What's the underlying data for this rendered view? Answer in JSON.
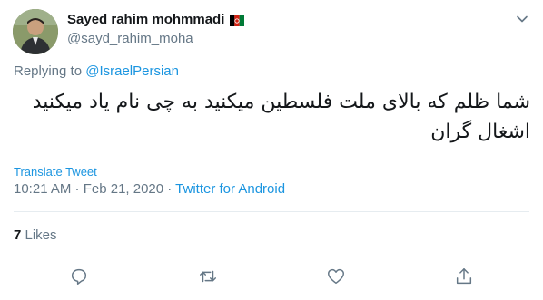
{
  "user": {
    "display_name": "Sayed rahim mohmmadi",
    "handle": "@sayd_rahim_moha",
    "flag_icon": "afghanistan-flag-icon",
    "avatar": "profile-avatar"
  },
  "reply": {
    "prefix": "Replying to ",
    "mention": "@IsraelPersian"
  },
  "tweet": {
    "text_line1": "شما ظلم که بالای ملت فلسطین میکنید به چی نام یاد میکنید",
    "text_line2": "اشغال گران",
    "translate_label": "Translate Tweet",
    "timestamp": "10:21 AM · Feb 21, 2020 · ",
    "source": "Twitter for Android"
  },
  "stats": {
    "likes_count": "7",
    "likes_label": " Likes"
  },
  "actions": {
    "reply": "reply-icon",
    "retweet": "retweet-icon",
    "like": "heart-icon",
    "share": "share-icon",
    "more": "chevron-down-icon"
  },
  "colors": {
    "link": "#1b95e0",
    "muted": "#657786",
    "text": "#14171a",
    "divider": "#e6ecf0"
  }
}
